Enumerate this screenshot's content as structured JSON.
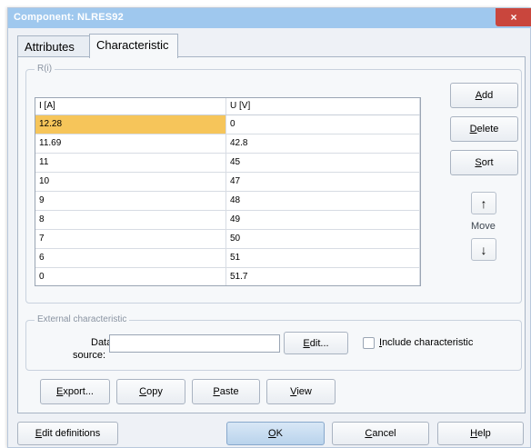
{
  "window": {
    "title": "Component: NLRES92",
    "close": "×"
  },
  "tabs": [
    {
      "label": "Attributes",
      "active": false
    },
    {
      "label": "Characteristic",
      "active": true
    }
  ],
  "ri_group": {
    "label": "R(i)"
  },
  "table": {
    "columns": [
      "I [A]",
      "U [V]"
    ],
    "rows": [
      [
        "12.28",
        "0"
      ],
      [
        "11.69",
        "42.8"
      ],
      [
        "11",
        "45"
      ],
      [
        "10",
        "47"
      ],
      [
        "9",
        "48"
      ],
      [
        "8",
        "49"
      ],
      [
        "7",
        "50"
      ],
      [
        "6",
        "51"
      ],
      [
        "0",
        "51.7"
      ]
    ],
    "selected_cell": "12.28"
  },
  "side_buttons": {
    "add": {
      "first": "A",
      "rest": "dd"
    },
    "delete": {
      "first": "D",
      "rest": "elete"
    },
    "sort": {
      "first": "S",
      "rest": "ort"
    },
    "move_label": "Move",
    "up_icon": "↑",
    "down_icon": "↓"
  },
  "external": {
    "group_label": "External characteristic",
    "data_label_1": "Data",
    "data_label_2": "source:",
    "data_value": "",
    "edit": {
      "first": "E",
      "rest": "dit..."
    },
    "include": {
      "first": "I",
      "rest": "nclude characteristic"
    }
  },
  "action_buttons": {
    "export": {
      "first": "E",
      "rest": "xport..."
    },
    "copy": {
      "first": "C",
      "rest": "opy"
    },
    "paste": {
      "first": "P",
      "rest": "aste"
    },
    "view": {
      "first": "V",
      "rest": "iew"
    }
  },
  "footer": {
    "edit_definitions": {
      "first": "E",
      "rest": "dit definitions"
    },
    "ok": {
      "first": "O",
      "rest": "K"
    },
    "cancel": {
      "first": "C",
      "rest": "ancel"
    },
    "help": {
      "first": "H",
      "rest": "elp"
    }
  }
}
